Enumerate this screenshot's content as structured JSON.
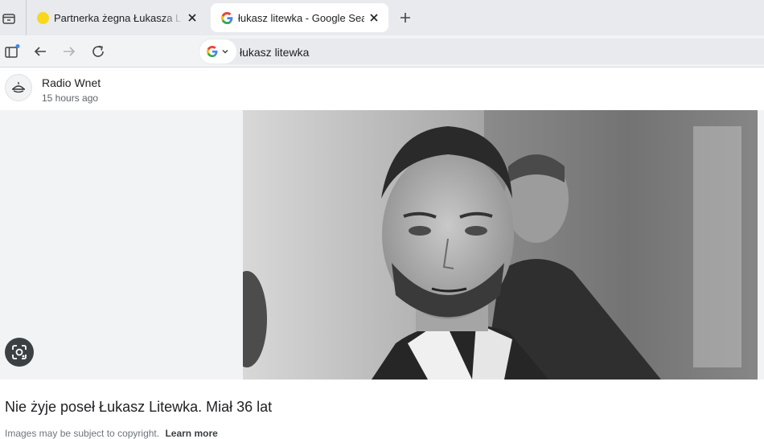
{
  "tabs": [
    {
      "title": "Partnerka żegna Łukasza Litewka",
      "favicon": "yellow-circle-icon",
      "favicon_color": "#f9d71c",
      "active": false
    },
    {
      "title": "łukasz litewka - Google Search",
      "favicon": "google-g-icon",
      "active": true
    }
  ],
  "toolbar": {
    "address_text": "łukasz litewka",
    "search_engine_icon": "google-g-icon"
  },
  "source": {
    "name": "Radio Wnet",
    "time": "15 hours ago"
  },
  "image": {
    "alt": "Nie żyje poseł Łukasz Litewka. Miał 36 lat"
  },
  "headline": "Nie żyje poseł Łukasz Litewka. Miał 36 lat",
  "copyright": {
    "text": "Images may be subject to copyright.",
    "link": "Learn more"
  },
  "colors": {
    "tab_strip": "#e8eaed",
    "toolbar": "#f1f3f4",
    "accent_blue": "#4285f4"
  }
}
